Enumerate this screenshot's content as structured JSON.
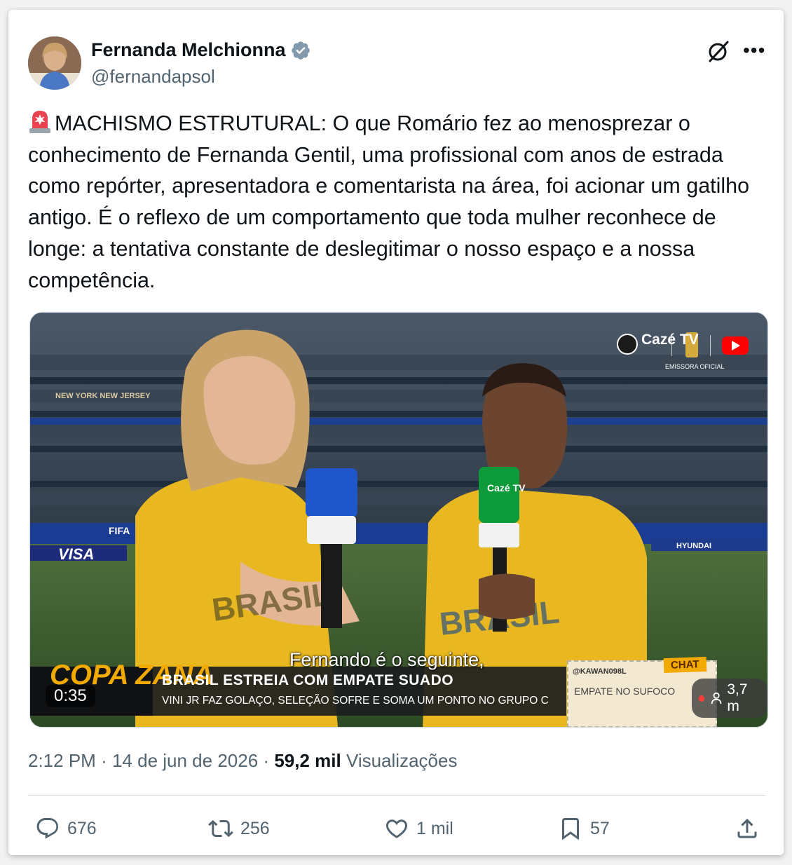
{
  "author": {
    "name": "Fernanda Melchionna",
    "handle": "@fernandapsol"
  },
  "post": {
    "text": "MACHISMO ESTRUTURAL: O que Romário fez ao menosprezar o conhecimento de Fernanda Gentil, uma profissional com anos de estrada como repórter, apresentadora e comentarista na área, foi acionar um gatilho antigo. É o reflexo de um comportamento que toda mulher reconhece de longe: a tentativa constante de deslegitimar o nosso espaço e a nossa competência."
  },
  "video": {
    "duration": "0:35",
    "subtitle": "Fernando é o seguinte,",
    "chyron_title": "BRASIL ESTREIA COM EMPATE SUADO",
    "chyron_sub": "VINI JR FAZ GOLAÇO, SELEÇÃO SOFRE E SOMA UM PONTO NO GRUPO C",
    "show_logo": "COPA ZANA",
    "chat_label": "CHAT",
    "chat_user": "@KAWAN098L",
    "chat_message": "EMPATE NO SUFOCO",
    "viewers": "3,7 m",
    "brand": "Cazé TV",
    "brand_caption": "EMISSORA OFICIAL",
    "stadium_sign_left": "NEW YORK NEW JERSEY",
    "sponsor_visa": "VISA",
    "sponsor_hyundai": "HYUNDAI",
    "fifa_text": "FIFA",
    "mic_label": "Cazé TV",
    "shirt_text": "BRASIL"
  },
  "meta": {
    "time": "2:12 PM",
    "separator": "·",
    "date": "14 de jun de 2026",
    "views_count": "59,2 mil",
    "views_label": "Visualizações"
  },
  "actions": {
    "replies": "676",
    "reposts": "256",
    "likes": "1 mil",
    "bookmarks": "57"
  },
  "colors": {
    "text": "#0f1419",
    "secondary": "#536471",
    "verified": "#829aab",
    "divider": "#cfd9de"
  }
}
